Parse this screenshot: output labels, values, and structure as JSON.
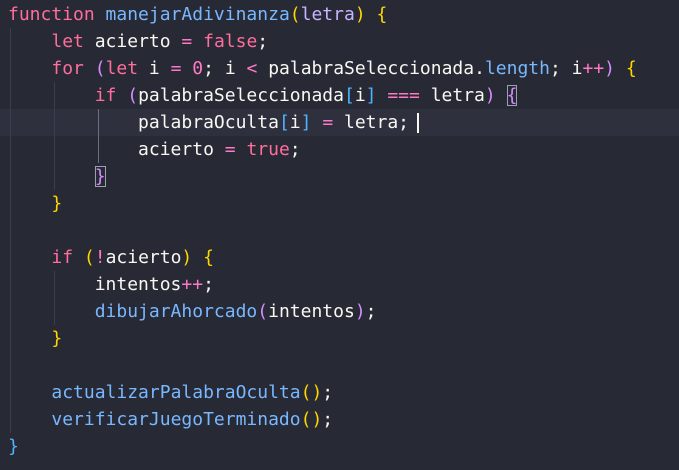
{
  "editor": {
    "language": "javascript",
    "lines": [
      [
        {
          "t": "function ",
          "c": "kw"
        },
        {
          "t": "manejarAdivinanza",
          "c": "fn"
        },
        {
          "t": "(",
          "c": "brace1"
        },
        {
          "t": "letra",
          "c": "param"
        },
        {
          "t": ")",
          "c": "brace1"
        },
        {
          "t": " ",
          "c": "punc"
        },
        {
          "t": "{",
          "c": "brace1"
        }
      ],
      [
        {
          "t": "    ",
          "c": "punc"
        },
        {
          "t": "let ",
          "c": "kw"
        },
        {
          "t": "acierto ",
          "c": "var"
        },
        {
          "t": "= ",
          "c": "op"
        },
        {
          "t": "false",
          "c": "bool"
        },
        {
          "t": ";",
          "c": "punc"
        }
      ],
      [
        {
          "t": "    ",
          "c": "punc"
        },
        {
          "t": "for ",
          "c": "kw"
        },
        {
          "t": "(",
          "c": "brace2"
        },
        {
          "t": "let ",
          "c": "kw"
        },
        {
          "t": "i ",
          "c": "var"
        },
        {
          "t": "= ",
          "c": "op"
        },
        {
          "t": "0",
          "c": "num"
        },
        {
          "t": "; i ",
          "c": "var"
        },
        {
          "t": "< ",
          "c": "op"
        },
        {
          "t": "palabraSeleccionada.",
          "c": "var"
        },
        {
          "t": "length",
          "c": "prop"
        },
        {
          "t": "; i",
          "c": "var"
        },
        {
          "t": "++",
          "c": "op"
        },
        {
          "t": ")",
          "c": "brace2"
        },
        {
          "t": " ",
          "c": "punc"
        },
        {
          "t": "{",
          "c": "brace1"
        }
      ],
      [
        {
          "t": "        ",
          "c": "punc"
        },
        {
          "t": "if ",
          "c": "kw"
        },
        {
          "t": "(",
          "c": "brace2"
        },
        {
          "t": "palabraSeleccionada",
          "c": "var"
        },
        {
          "t": "[",
          "c": "brace3"
        },
        {
          "t": "i",
          "c": "var"
        },
        {
          "t": "]",
          "c": "brace3"
        },
        {
          "t": " ",
          "c": "punc"
        },
        {
          "t": "=== ",
          "c": "op"
        },
        {
          "t": "letra",
          "c": "var"
        },
        {
          "t": ")",
          "c": "brace2"
        },
        {
          "t": " ",
          "c": "punc"
        },
        {
          "t": "{",
          "c": "brace2",
          "m": true
        }
      ],
      [
        {
          "t": "            ",
          "c": "punc"
        },
        {
          "t": "palabraOculta",
          "c": "var"
        },
        {
          "t": "[",
          "c": "brace3"
        },
        {
          "t": "i",
          "c": "var"
        },
        {
          "t": "]",
          "c": "brace3"
        },
        {
          "t": " ",
          "c": "punc"
        },
        {
          "t": "= ",
          "c": "op"
        },
        {
          "t": "letra;",
          "c": "var"
        }
      ],
      [
        {
          "t": "            ",
          "c": "punc"
        },
        {
          "t": "acierto ",
          "c": "var"
        },
        {
          "t": "= ",
          "c": "op"
        },
        {
          "t": "true",
          "c": "bool"
        },
        {
          "t": ";",
          "c": "punc"
        }
      ],
      [
        {
          "t": "        ",
          "c": "punc"
        },
        {
          "t": "}",
          "c": "brace2",
          "m": true
        }
      ],
      [
        {
          "t": "    ",
          "c": "punc"
        },
        {
          "t": "}",
          "c": "brace1"
        }
      ],
      [],
      [
        {
          "t": "    ",
          "c": "punc"
        },
        {
          "t": "if ",
          "c": "kw"
        },
        {
          "t": "(",
          "c": "brace1"
        },
        {
          "t": "!",
          "c": "op"
        },
        {
          "t": "acierto",
          "c": "var"
        },
        {
          "t": ")",
          "c": "brace1"
        },
        {
          "t": " ",
          "c": "punc"
        },
        {
          "t": "{",
          "c": "brace1"
        }
      ],
      [
        {
          "t": "        ",
          "c": "punc"
        },
        {
          "t": "intentos",
          "c": "var"
        },
        {
          "t": "++",
          "c": "op"
        },
        {
          "t": ";",
          "c": "punc"
        }
      ],
      [
        {
          "t": "        ",
          "c": "punc"
        },
        {
          "t": "dibujarAhorcado",
          "c": "fn"
        },
        {
          "t": "(",
          "c": "brace2"
        },
        {
          "t": "intentos",
          "c": "var"
        },
        {
          "t": ")",
          "c": "brace2"
        },
        {
          "t": ";",
          "c": "punc"
        }
      ],
      [
        {
          "t": "    ",
          "c": "punc"
        },
        {
          "t": "}",
          "c": "brace1"
        }
      ],
      [],
      [
        {
          "t": "    ",
          "c": "punc"
        },
        {
          "t": "actualizarPalabraOculta",
          "c": "fn"
        },
        {
          "t": "(",
          "c": "brace1"
        },
        {
          "t": ")",
          "c": "brace1"
        },
        {
          "t": ";",
          "c": "punc"
        }
      ],
      [
        {
          "t": "    ",
          "c": "punc"
        },
        {
          "t": "verificarJuegoTerminado",
          "c": "fn"
        },
        {
          "t": "(",
          "c": "brace1"
        },
        {
          "t": ")",
          "c": "brace1"
        },
        {
          "t": ";",
          "c": "punc"
        }
      ],
      [
        {
          "t": "}",
          "c": "brace3"
        }
      ]
    ]
  }
}
